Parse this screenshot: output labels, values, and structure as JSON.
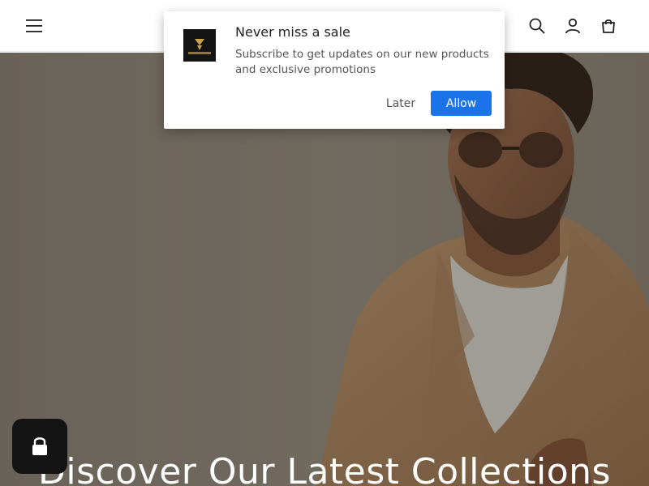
{
  "header": {
    "menu_icon": "hamburger-menu-icon",
    "search_icon": "search-icon",
    "account_icon": "user-account-icon",
    "cart_icon": "shopping-bag-icon"
  },
  "popup": {
    "title": "Never miss a sale",
    "text": "Subscribe to get updates on our new products and exclusive promotions",
    "later_label": "Later",
    "allow_label": "Allow",
    "allow_color": "#1a73e8"
  },
  "hero": {
    "title": "Discover Our Latest Collections"
  },
  "chat": {
    "icon": "lock-icon",
    "bg_color": "#141414"
  }
}
